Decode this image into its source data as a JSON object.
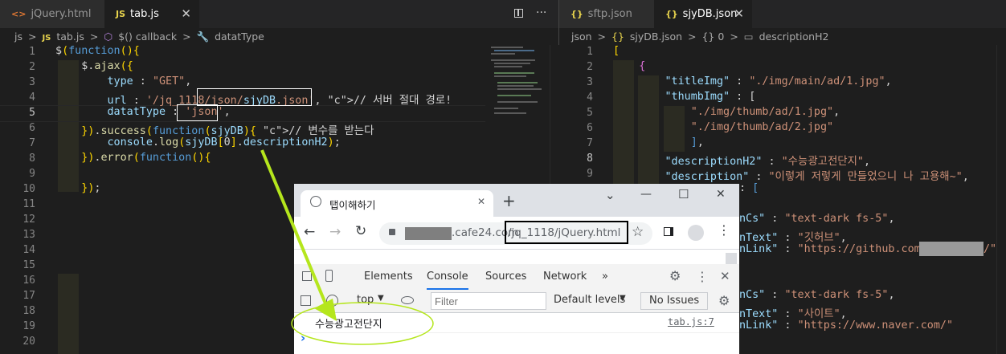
{
  "left_editor": {
    "tabs": [
      {
        "icon": "<>",
        "label": "jQuery.html",
        "active": false
      },
      {
        "icon": "JS",
        "label": "tab.js",
        "active": true,
        "close": "✕"
      }
    ],
    "breadcrumb": [
      "js",
      ">",
      "JS",
      "tab.js",
      ">",
      "$() callback",
      ">",
      "datatType"
    ],
    "line_numbers": [
      "1",
      "2",
      "3",
      "4",
      "5",
      "6",
      "7",
      "8",
      "9",
      "10",
      "11",
      "12",
      "13",
      "14",
      "15",
      "16",
      "17",
      "18",
      "19",
      "20"
    ],
    "current_line": "5",
    "lines": [
      "$(function(){",
      "    $.ajax({",
      "        type : \"GET\",",
      "        url : '/jq_1118/json/sjyDB.json', // 서버 절대 경로!",
      "        datatType : 'json',",
      "    }).success(function(sjyDB){ // 변수를 받는다",
      "        console.log(sjyDB[0].descriptionH2);",
      "    }).error(function(){",
      "",
      "    });"
    ]
  },
  "right_editor": {
    "tabs": [
      {
        "icon": "{}",
        "label": "sftp.json",
        "active": false
      },
      {
        "icon": "{}",
        "label": "sjyDB.json",
        "active": true,
        "close": "✕"
      }
    ],
    "breadcrumb": [
      "json",
      ">",
      "{}",
      "sjyDB.json",
      ">",
      "{} 0",
      ">",
      "▭",
      "descriptionH2"
    ],
    "line_numbers": [
      "1",
      "2",
      "3",
      "4",
      "5",
      "6",
      "7",
      "8",
      "9"
    ],
    "current_line": "8",
    "lines": [
      "[",
      "    {",
      "        \"titleImg\" : \"./img/main/ad/1.jpg\",",
      "        \"thumbImg\" : [",
      "            \"./img/thumb/ad/1.jpg\",",
      "            \"./img/thumb/ad/2.jpg\"",
      "            ],",
      "        \"descriptionH2\" : \"수능광고전단지\",",
      "        \"description\" : \"이렇게 저렇게 만들었으니 나 고용해~\","
    ],
    "partial_lines": [
      ": [",
      "nCs\" : \"text-dark fs-5\",",
      "nText\" : \"깃허브\",",
      "nLink\" : \"https://github.com/j",
      "/\"",
      "nCs\" : \"text-dark fs-5\",",
      "nText\" : \"사이트\",",
      "nLink\" : \"https://www.naver.com/\""
    ]
  },
  "browser": {
    "tab_title": "탭이해하기",
    "tab_close": "✕",
    "new_tab": "+",
    "window_controls": [
      "⌄",
      "—",
      "☐",
      "✕"
    ],
    "nav": [
      "←",
      "→",
      "↻"
    ],
    "url_domain": ".cafe24.com",
    "url_path": "/jq_1118/jQuery.html",
    "devtools_tabs": [
      "Elements",
      "Console",
      "Sources",
      "Network",
      "»"
    ],
    "active_devtools_tab": "Console",
    "context": "top",
    "filter_placeholder": "Filter",
    "levels": "Default levels",
    "issues": "No Issues",
    "console_output": "수능광고전단지",
    "console_source": "tab.js:7",
    "prompt": "›"
  },
  "colors": {
    "editor_bg": "#1e1e1e",
    "arrow": "#b5e61d",
    "active_tab_accent": "#1a73e8"
  }
}
